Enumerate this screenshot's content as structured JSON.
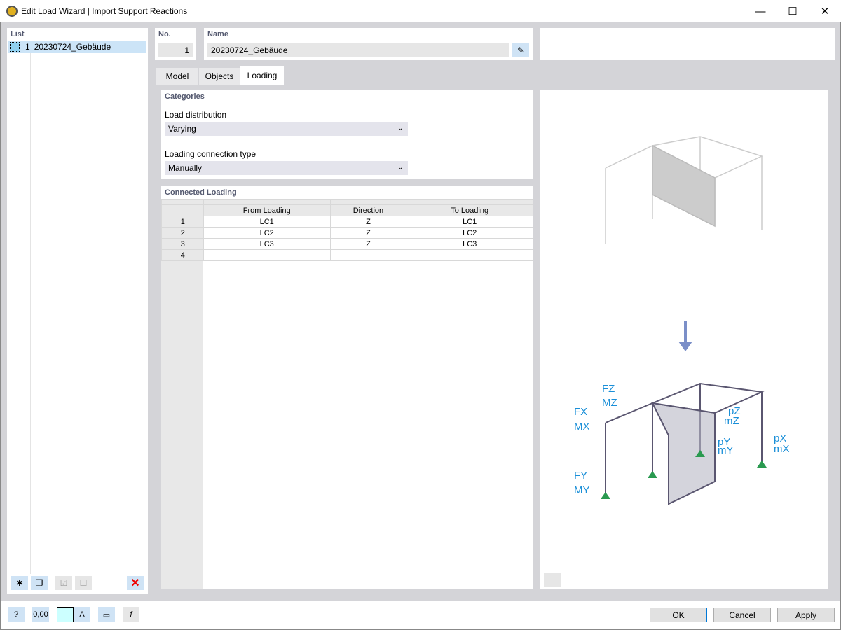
{
  "window": {
    "title": "Edit Load Wizard | Import Support Reactions",
    "minimize": "—",
    "maximize": "☐",
    "close": "✕"
  },
  "list": {
    "label": "List",
    "items": [
      {
        "no": "1",
        "name": "20230724_Gebäude"
      }
    ]
  },
  "header": {
    "no_label": "No.",
    "no_value": "1",
    "name_label": "Name",
    "name_value": "20230724_Gebäude"
  },
  "tabs": [
    {
      "label": "Model"
    },
    {
      "label": "Objects"
    },
    {
      "label": "Loading",
      "active": true
    }
  ],
  "categories": {
    "title": "Categories",
    "load_distribution_label": "Load distribution",
    "load_distribution_value": "Varying",
    "connection_label": "Loading connection type",
    "connection_value": "Manually"
  },
  "connected": {
    "title": "Connected Loading",
    "columns": [
      "From Loading",
      "Direction",
      "To Loading"
    ],
    "rows": [
      [
        "1",
        "LC1",
        "Z",
        "LC1"
      ],
      [
        "2",
        "LC2",
        "Z",
        "LC2"
      ],
      [
        "3",
        "LC3",
        "Z",
        "LC3"
      ],
      [
        "4",
        "",
        "",
        ""
      ]
    ]
  },
  "diagram": {
    "labels": [
      "FZ",
      "MZ",
      "FX",
      "MX",
      "FY",
      "MY",
      "pZ",
      "mZ",
      "pY",
      "mY",
      "pX",
      "mX"
    ]
  },
  "footer": {
    "ok": "OK",
    "cancel": "Cancel",
    "apply": "Apply",
    "units_icon_text": "0,00"
  }
}
